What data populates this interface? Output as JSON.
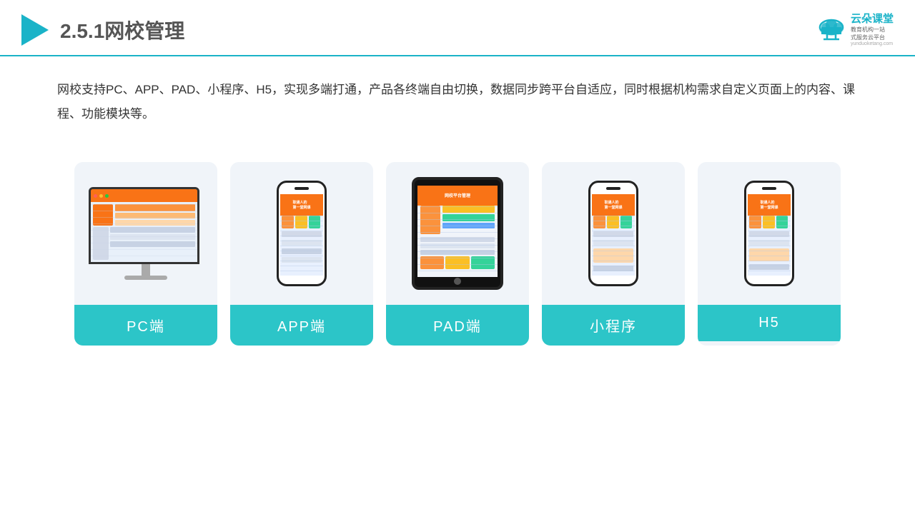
{
  "header": {
    "title_prefix": "2.5.1",
    "title_main": "网校管理",
    "logo_brand": "云朵课堂",
    "logo_slogan": "教育机构一站\n式服务云平台",
    "logo_domain": "yunduoketang.com"
  },
  "description": {
    "text": "网校支持PC、APP、PAD、小程序、H5，实现多端打通，产品各终端自由切换，数据同步跨平台自适应，同时根据机构需求自定义页面上的内容、课程、功能模块等。"
  },
  "cards": [
    {
      "id": "pc",
      "label": "PC端",
      "device": "pc"
    },
    {
      "id": "app",
      "label": "APP端",
      "device": "phone"
    },
    {
      "id": "pad",
      "label": "PAD端",
      "device": "tablet"
    },
    {
      "id": "miniprogram",
      "label": "小程序",
      "device": "phone"
    },
    {
      "id": "h5",
      "label": "H5",
      "device": "phone"
    }
  ],
  "colors": {
    "accent": "#2cc5c8",
    "header_line": "#1ab3c8",
    "card_bg": "#eef2f8",
    "label_bg": "#2cc5c8"
  }
}
